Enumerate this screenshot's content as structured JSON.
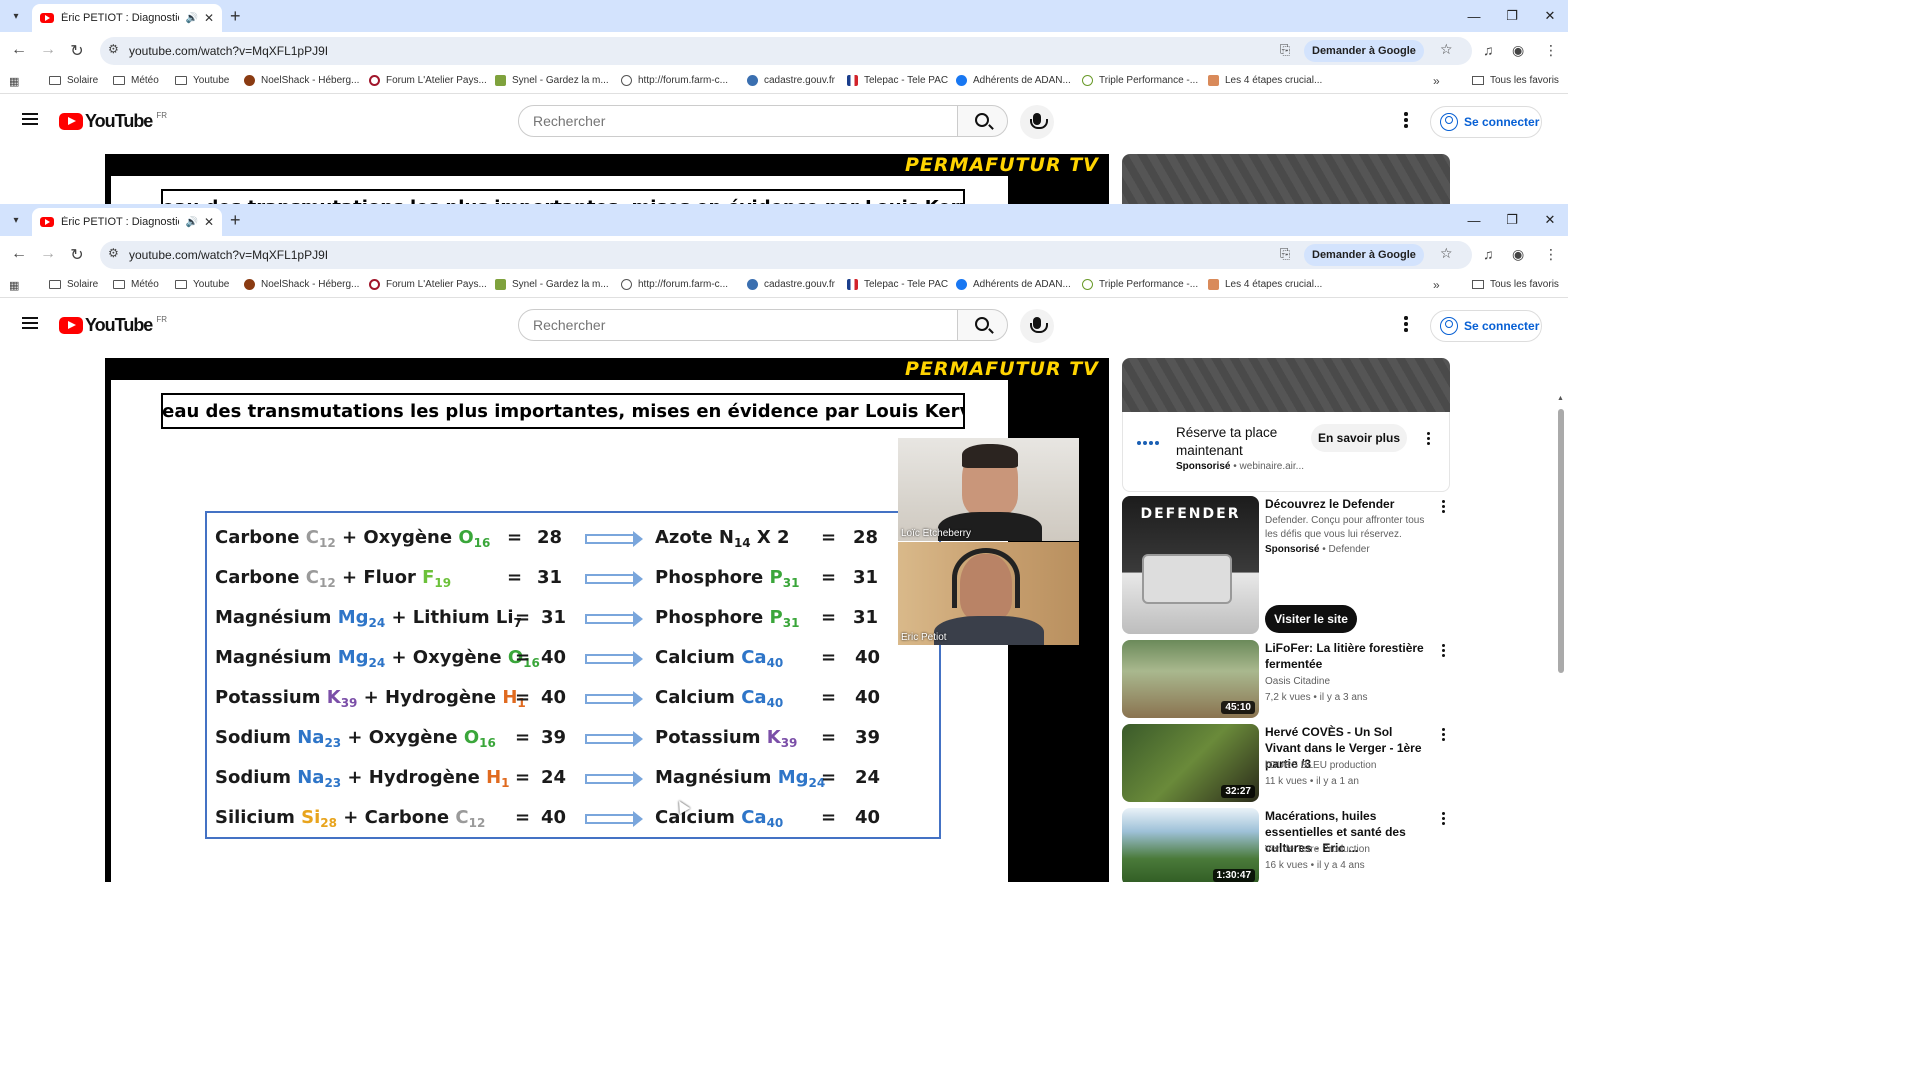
{
  "browser": {
    "tab_title": "Éric PETIOT : Diagnostic et c",
    "url": "youtube.com/watch?v=MqXFL1pPJ9I",
    "ask_google": "Demander à Google",
    "bookmarks": [
      "Solaire",
      "Météo",
      "Youtube",
      "NoelShack - Héberg...",
      "Forum L'Atelier Pays...",
      "Synel - Gardez la m...",
      "http://forum.farm-c...",
      "cadastre.gouv.fr",
      "Telepac - Tele PAC",
      "Adhérents de ADAN...",
      "Triple Performance -...",
      "Les 4 étapes crucial..."
    ],
    "all_bookmarks": "Tous les favoris"
  },
  "youtube": {
    "logo": "YouTube",
    "region": "FR",
    "search_placeholder": "Rechercher",
    "signin": "Se connecter"
  },
  "video": {
    "brand": "PERMAFUTUR TV",
    "slide_title": "Tableau des transmutations les plus importantes, mises en évidence par Louis Kervran",
    "top_title_fragment": "Tableau des transmutations les plus importantes, mises en évidence par Louis Kervran",
    "equations": [
      {
        "a": "Carbone",
        "as": "C",
        "an": "12",
        "ac": "gray",
        "b": "Oxygène",
        "bs": "O",
        "bn": "16",
        "bc": "green",
        "sum": "28",
        "r": "Azote",
        "rs": "N",
        "rn": "14",
        "rc": "dark",
        "extra": "X 2",
        "res": "28"
      },
      {
        "a": "Carbone",
        "as": "C",
        "an": "12",
        "ac": "gray",
        "b": "Fluor",
        "bs": "F",
        "bn": "19",
        "bc": "lime",
        "sum": "31",
        "r": "Phosphore",
        "rs": "P",
        "rn": "31",
        "rc": "green",
        "extra": "",
        "res": "31"
      },
      {
        "a": "Magnésium",
        "as": "Mg",
        "an": "24",
        "ac": "blue",
        "b": "Lithium",
        "bs": "Li",
        "bn": "7",
        "bc": "dark",
        "sum": "31",
        "r": "Phosphore",
        "rs": "P",
        "rn": "31",
        "rc": "green",
        "extra": "",
        "res": "31"
      },
      {
        "a": "Magnésium",
        "as": "Mg",
        "an": "24",
        "ac": "blue",
        "b": "Oxygène",
        "bs": "O",
        "bn": "16",
        "bc": "green",
        "sum": "40",
        "r": "Calcium",
        "rs": "Ca",
        "rn": "40",
        "rc": "blue",
        "extra": "",
        "res": "40"
      },
      {
        "a": "Potassium",
        "as": "K",
        "an": "39",
        "ac": "purple",
        "b": "Hydrogène",
        "bs": "H",
        "bn": "1",
        "bc": "orange",
        "sum": "40",
        "r": "Calcium",
        "rs": "Ca",
        "rn": "40",
        "rc": "blue",
        "extra": "",
        "res": "40"
      },
      {
        "a": "Sodium",
        "as": "Na",
        "an": "23",
        "ac": "blue",
        "b": "Oxygène",
        "bs": "O",
        "bn": "16",
        "bc": "green",
        "sum": "39",
        "r": "Potassium",
        "rs": "K",
        "rn": "39",
        "rc": "purple",
        "extra": "",
        "res": "39"
      },
      {
        "a": "Sodium",
        "as": "Na",
        "an": "23",
        "ac": "blue",
        "b": "Hydrogène",
        "bs": "H",
        "bn": "1",
        "bc": "orange",
        "sum": "24",
        "r": "Magnésium",
        "rs": "Mg",
        "rn": "24",
        "rc": "blue",
        "extra": "",
        "res": "24"
      },
      {
        "a": "Silicium",
        "as": "Si",
        "an": "28",
        "ac": "yellow",
        "b": "Carbone",
        "bs": "C",
        "bn": "12",
        "bc": "gray",
        "sum": "40",
        "r": "Calcium",
        "rs": "Ca",
        "rn": "40",
        "rc": "blue",
        "extra": "",
        "res": "40"
      }
    ],
    "participants": [
      "Loïc Etcheberry",
      "Eric Petiot"
    ]
  },
  "sidebar": {
    "ad": {
      "title": "Réserve ta place maintenant",
      "sponsored": "Sponsorisé",
      "advertiser": "webinaire.air...",
      "button": "En savoir plus"
    },
    "defender": {
      "title": "Découvrez le Defender",
      "desc": "Defender. Conçu pour affronter tous les défis que vous lui réservez.",
      "sponsored": "Sponsorisé",
      "channel": "Defender",
      "button": "Visiter le site",
      "thumb_text": "DEFENDER"
    },
    "videos": [
      {
        "title": "LiFoFer: La litière forestière fermentée",
        "channel": "Oasis Citadine",
        "meta": "7,2 k vues • il y a 3 ans",
        "duration": "45:10"
      },
      {
        "title": "Hervé COVÈS - Un Sol Vivant dans le Verger - 1ère partie /3",
        "channel": "l'OURS BLEU production",
        "meta": "11 k vues • il y a 1 an",
        "duration": "32:27"
      },
      {
        "title": "Macérations, huiles essentielles et santé des cultures - Eric ...",
        "channel": "Ver de Terre Production",
        "meta": "16 k vues • il y a 4 ans",
        "duration": "1:30:47"
      }
    ]
  },
  "colors": {
    "accent": "#065fd4",
    "tabbar": "#d3e3fd",
    "brand": "#ffd400",
    "yt_red": "#ff0000"
  }
}
